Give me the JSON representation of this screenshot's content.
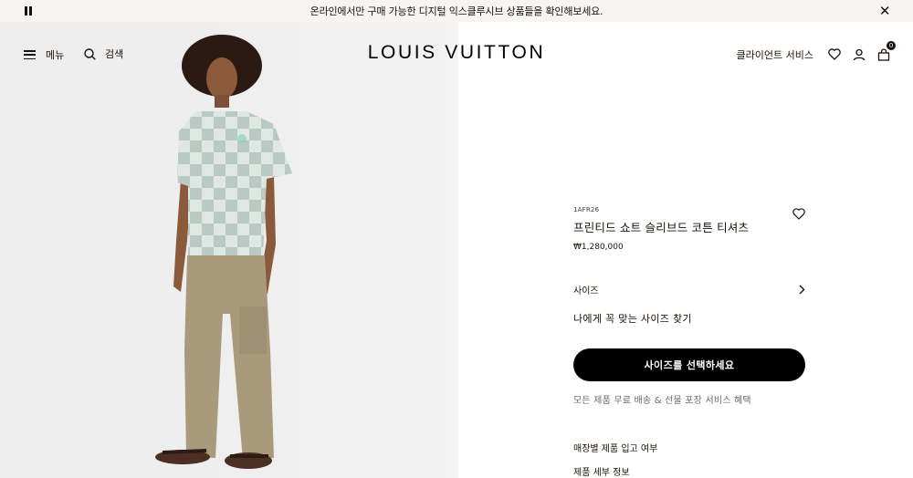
{
  "announcement": {
    "text": "온라인에서만 구매 가능한 디지털 익스클루시브 상품들을 확인해보세요.",
    "pause_icon": "pause-icon",
    "close_icon": "close-icon"
  },
  "header": {
    "menu_label": "메뉴",
    "search_label": "검색",
    "logo": "LOUIS VUITTON",
    "client_service": "클라이언트 서비스",
    "cart_count": "0"
  },
  "product": {
    "sku": "1AFR26",
    "name": "프린티드 쇼트 슬리브드 코튼 티셔츠",
    "price": "₩1,280,000",
    "size_label": "사이즈",
    "size_finder": "나에게 꼭 맞는 사이즈 찾기",
    "cta": "사이즈를 선택하세요",
    "services": "모든 제품 무료 배송 & 선물 포장 서비스 혜택",
    "store_stock": "매장별 제품 입고 여부",
    "details": "제품 세부 정보"
  },
  "colors": {
    "brand_dark": "#19110b",
    "image_bg": "#efefef",
    "shirt_light": "#dfe7e3",
    "shirt_dark": "#b7c7c1",
    "pants": "#a99a7c"
  }
}
